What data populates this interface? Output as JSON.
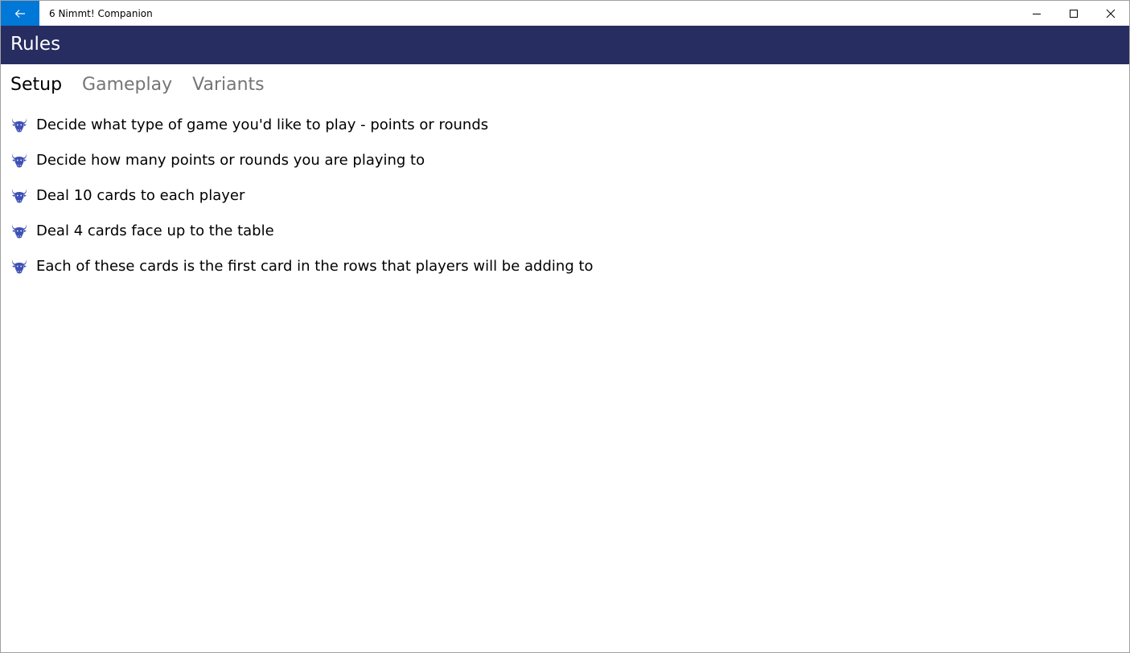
{
  "window": {
    "title": "6 Nimmt! Companion"
  },
  "header": {
    "title": "Rules"
  },
  "tabs": [
    {
      "label": "Setup",
      "active": true
    },
    {
      "label": "Gameplay",
      "active": false
    },
    {
      "label": "Variants",
      "active": false
    }
  ],
  "rules": [
    {
      "text": "Decide what type of game you'd like to play - points or rounds",
      "icon": "bull-head-icon"
    },
    {
      "text": "Decide how many points or rounds you are playing to",
      "icon": "bull-head-icon"
    },
    {
      "text": "Deal 10 cards to each player",
      "icon": "bull-head-icon"
    },
    {
      "text": "Deal 4 cards face up to the table",
      "icon": "bull-head-icon"
    },
    {
      "text": "Each of these cards is the first card in the rows that players will be adding to",
      "icon": "bull-head-icon"
    }
  ],
  "colors": {
    "accent": "#0078d7",
    "header_bg": "#272d61",
    "icon": "#3f51b5",
    "tab_inactive": "#757575"
  }
}
